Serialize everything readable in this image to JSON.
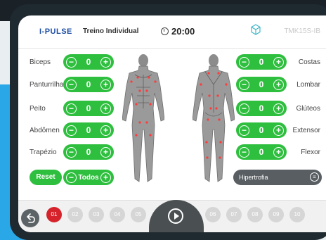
{
  "header": {
    "logo": "I-PULSE",
    "mode": "Treino Individual",
    "timer": "20:00",
    "device": "TMK15S-IB"
  },
  "left_muscles": [
    {
      "label": "Biceps",
      "value": "0"
    },
    {
      "label": "Panturrilhas",
      "value": "0"
    },
    {
      "label": "Peito",
      "value": "0"
    },
    {
      "label": "Abdômen",
      "value": "0"
    },
    {
      "label": "Trapézio",
      "value": "0"
    }
  ],
  "right_muscles": [
    {
      "label": "Costas",
      "value": "0"
    },
    {
      "label": "Lombar",
      "value": "0"
    },
    {
      "label": "Glúteos",
      "value": "0"
    },
    {
      "label": "Extensor",
      "value": "0"
    },
    {
      "label": "Flexor",
      "value": "0"
    }
  ],
  "controls": {
    "reset": "Reset",
    "todos": "Todos",
    "program": "Hipertrofia",
    "minus": "−",
    "plus": "+"
  },
  "channels": [
    "01",
    "02",
    "03",
    "04",
    "05",
    "06",
    "07",
    "08",
    "09",
    "10"
  ],
  "colors": {
    "accent": "#2fbf3f",
    "active_channel": "#d6222a",
    "logo": "#1e4fa3"
  }
}
